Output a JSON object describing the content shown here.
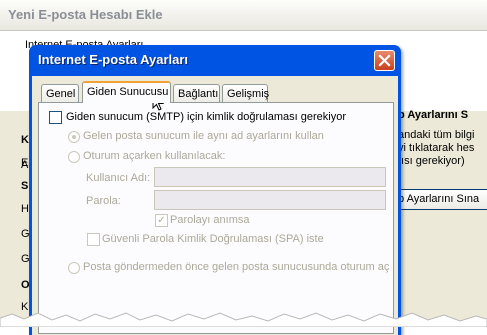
{
  "background_window": {
    "title": "Yeni E-posta Hesabı Ekle",
    "subtitle": "Internet E-posta Ayarları",
    "left_labels": [
      "Ku",
      "Ad",
      "E-",
      "Su",
      "He",
      "Ge",
      "Gi",
      "Ot",
      "Ku"
    ],
    "right_texts": [
      "p Ayarlarını S",
      "andaki tüm bilgi",
      "yi tıklatarak hes",
      "tısı gerekiyor)"
    ],
    "button_label": "p Ayarlarını Sına"
  },
  "dialog": {
    "title": "Internet E-posta Ayarları",
    "close_icon": "close-icon",
    "tabs": [
      {
        "label": "Genel"
      },
      {
        "label": "Giden Sunucusu",
        "active": true
      },
      {
        "label": "Bağlantı"
      },
      {
        "label": "Gelişmiş"
      }
    ],
    "outgoing": {
      "require_auth_label": "Giden sunucum (SMTP) için kimlik doğrulaması gerekiyor",
      "require_auth_checked": false,
      "same_settings_label": "Gelen posta sunucum ile aynı ad ayarlarını kullan",
      "logon_using_label": "Oturum açarken kullanılacak:",
      "username_label": "Kullanıcı Adı:",
      "username_value": "",
      "password_label": "Parola:",
      "password_value": "",
      "remember_password_label": "Parolayı anımsa",
      "remember_password_checked": true,
      "spa_label": "Güvenli Parola Kimlik Doğrulaması (SPA) iste",
      "spa_checked": false,
      "logon_incoming_first_label": "Posta göndermeden önce gelen posta sunucusunda oturum aç"
    }
  },
  "colors": {
    "titlebar_blue": "#0054e3",
    "dialog_face": "#ece9d8",
    "disabled_text": "#aca899",
    "active_tab_accent": "#f0a33a"
  }
}
